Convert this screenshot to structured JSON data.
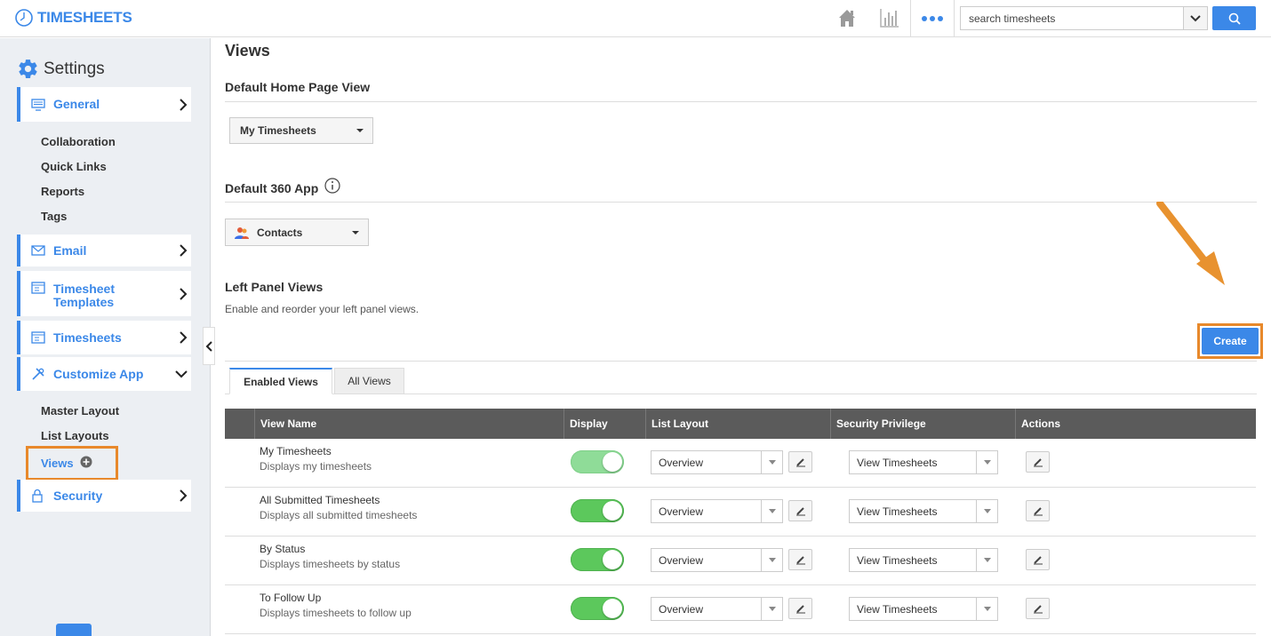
{
  "app": {
    "title": "TIMESHEETS"
  },
  "search": {
    "placeholder": "search timesheets"
  },
  "sidebar": {
    "title": "Settings",
    "general": "General",
    "general_items": [
      "Collaboration",
      "Quick Links",
      "Reports",
      "Tags"
    ],
    "email": "Email",
    "timesheet_templates_line1": "Timesheet",
    "timesheet_templates_line2": "Templates",
    "timesheets": "Timesheets",
    "customize_app": "Customize App",
    "customize_items": [
      "Master Layout",
      "List Layouts"
    ],
    "views": "Views",
    "security": "Security"
  },
  "main": {
    "title": "Views",
    "home_page_section": "Default Home Page View",
    "home_page_value": "My Timesheets",
    "app360_section": "Default 360 App",
    "app360_value": "Contacts",
    "left_panel_section": "Left Panel Views",
    "left_panel_desc": "Enable and reorder your left panel views.",
    "create_label": "Create",
    "tabs": [
      "Enabled Views",
      "All Views"
    ],
    "columns": [
      "View Name",
      "Display",
      "List Layout",
      "Security Privilege",
      "Actions"
    ],
    "rows": [
      {
        "name": "My Timesheets",
        "desc": "Displays my timesheets",
        "layout": "Overview",
        "privilege": "View Timesheets",
        "enabled": true
      },
      {
        "name": "All Submitted Timesheets",
        "desc": "Displays all submitted timesheets",
        "layout": "Overview",
        "privilege": "View Timesheets",
        "enabled": true
      },
      {
        "name": "By Status",
        "desc": "Displays timesheets by status",
        "layout": "Overview",
        "privilege": "View Timesheets",
        "enabled": true
      },
      {
        "name": "To Follow Up",
        "desc": "Displays timesheets to follow up",
        "layout": "Overview",
        "privilege": "View Timesheets",
        "enabled": true
      }
    ]
  },
  "colors": {
    "accent": "#3b88e8",
    "highlight": "#e8892b",
    "toggle_on": "#5cc85c"
  }
}
